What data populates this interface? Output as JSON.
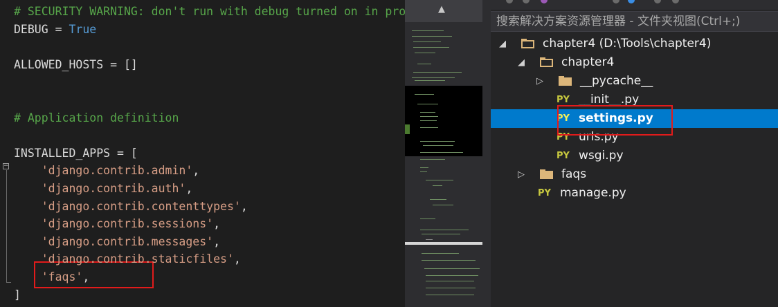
{
  "editor": {
    "lines": [
      {
        "parts": [
          {
            "t": "# SECURITY WARNING: don't run with debug turned on in production!",
            "c": "cmt"
          }
        ]
      },
      {
        "parts": [
          {
            "t": "DEBUG = ",
            "c": "txt"
          },
          {
            "t": "True",
            "c": "kw"
          }
        ]
      },
      {
        "parts": []
      },
      {
        "parts": [
          {
            "t": "ALLOWED_HOSTS = []",
            "c": "txt"
          }
        ]
      },
      {
        "parts": []
      },
      {
        "parts": []
      },
      {
        "parts": [
          {
            "t": "# Application definition",
            "c": "cmt"
          }
        ]
      },
      {
        "parts": []
      },
      {
        "parts": [
          {
            "t": "INSTALLED_APPS = [",
            "c": "txt"
          }
        ]
      },
      {
        "parts": [
          {
            "t": "    'django.contrib.admin'",
            "c": "str"
          },
          {
            "t": ",",
            "c": "txt"
          }
        ]
      },
      {
        "parts": [
          {
            "t": "    'django.contrib.auth'",
            "c": "str"
          },
          {
            "t": ",",
            "c": "txt"
          }
        ]
      },
      {
        "parts": [
          {
            "t": "    'django.contrib.contenttypes'",
            "c": "str"
          },
          {
            "t": ",",
            "c": "txt"
          }
        ]
      },
      {
        "parts": [
          {
            "t": "    'django.contrib.sessions'",
            "c": "str"
          },
          {
            "t": ",",
            "c": "txt"
          }
        ]
      },
      {
        "parts": [
          {
            "t": "    'django.contrib.messages'",
            "c": "str"
          },
          {
            "t": ",",
            "c": "txt"
          }
        ]
      },
      {
        "parts": [
          {
            "t": "    'django.contrib.staticfiles'",
            "c": "str"
          },
          {
            "t": ",",
            "c": "txt"
          }
        ]
      },
      {
        "parts": [
          {
            "t": "    'faqs'",
            "c": "str"
          },
          {
            "t": ",",
            "c": "txt"
          }
        ]
      },
      {
        "parts": [
          {
            "t": "]",
            "c": "txt"
          }
        ]
      }
    ],
    "fold_glyph": "−"
  },
  "minimap": {
    "scroll_up_glyph": "▲"
  },
  "explorer": {
    "search_placeholder": "搜索解决方案资源管理器 - 文件夹视图(Ctrl+;)",
    "items": [
      {
        "label": "chapter4 (D:\\Tools\\chapter4)",
        "type": "folder",
        "level": 0,
        "expanded": true,
        "twisty": "◢"
      },
      {
        "label": "chapter4",
        "type": "folder",
        "level": 1,
        "expanded": true,
        "twisty": "◢"
      },
      {
        "label": "__pycache__",
        "type": "folder-filled",
        "level": 2,
        "expanded": false,
        "twisty": "▷"
      },
      {
        "label": "__init__.py",
        "type": "py",
        "level": 2,
        "icon": "PY"
      },
      {
        "label": "settings.py",
        "type": "py",
        "level": 2,
        "icon": "PY",
        "selected": true
      },
      {
        "label": "urls.py",
        "type": "py",
        "level": 2,
        "icon": "PY"
      },
      {
        "label": "wsgi.py",
        "type": "py",
        "level": 2,
        "icon": "PY"
      },
      {
        "label": "faqs",
        "type": "folder-filled",
        "level": 1,
        "expanded": false,
        "twisty": "▷"
      },
      {
        "label": "manage.py",
        "type": "py",
        "level": 1,
        "icon": "PY"
      }
    ]
  },
  "colors": {
    "highlight_box": "#e21b1b",
    "selection": "#007acc",
    "comment": "#57a64a",
    "keyword": "#569cd6",
    "string": "#d69d85"
  }
}
